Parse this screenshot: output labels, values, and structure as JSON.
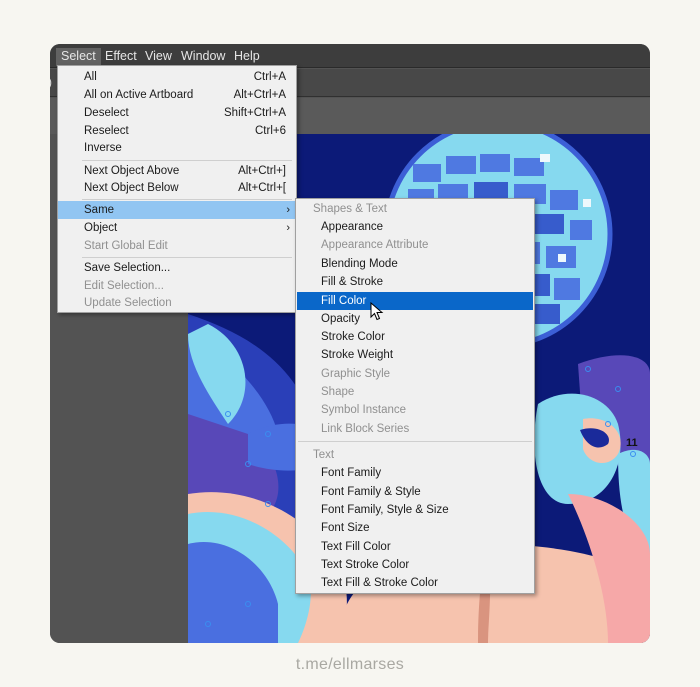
{
  "menubar": {
    "items": [
      {
        "label": "Select"
      },
      {
        "label": "Effect"
      },
      {
        "label": "View"
      },
      {
        "label": "Window"
      },
      {
        "label": "Help"
      }
    ]
  },
  "toolbar_glyph": ")",
  "select_menu": {
    "items": [
      {
        "label": "All",
        "shortcut": "Ctrl+A"
      },
      {
        "label": "All on Active Artboard",
        "shortcut": "Alt+Ctrl+A"
      },
      {
        "label": "Deselect",
        "shortcut": "Shift+Ctrl+A"
      },
      {
        "label": "Reselect",
        "shortcut": "Ctrl+6"
      },
      {
        "label": "Inverse",
        "shortcut": ""
      },
      {
        "label": "Next Object Above",
        "shortcut": "Alt+Ctrl+]"
      },
      {
        "label": "Next Object Below",
        "shortcut": "Alt+Ctrl+["
      },
      {
        "label": "Same",
        "shortcut": "›"
      },
      {
        "label": "Object",
        "shortcut": "›"
      },
      {
        "label": "Start Global Edit",
        "shortcut": ""
      },
      {
        "label": "Save Selection...",
        "shortcut": ""
      },
      {
        "label": "Edit Selection...",
        "shortcut": ""
      },
      {
        "label": "Update Selection",
        "shortcut": ""
      }
    ]
  },
  "same_menu": {
    "section1": "Shapes & Text",
    "items1": [
      "Appearance",
      "Appearance Attribute",
      "Blending Mode",
      "Fill & Stroke",
      "Fill Color",
      "Opacity",
      "Stroke Color",
      "Stroke Weight",
      "Graphic Style",
      "Shape",
      "Symbol Instance",
      "Link Block Series"
    ],
    "section2": "Text",
    "items2": [
      "Font Family",
      "Font Family & Style",
      "Font Family, Style & Size",
      "Font Size",
      "Text Fill Color",
      "Text Stroke Color",
      "Text Fill & Stroke Color"
    ]
  },
  "artwork": {
    "label": "11"
  },
  "caption": "t.me/ellmarses",
  "colors": {
    "menu_highlight_light": "#91c5f2",
    "menu_highlight_dark": "#0a67c9",
    "canvas_navy": "#0c1a78",
    "art_blue": "#4a6fe0",
    "art_cyan": "#86d9ef",
    "art_purple": "#5848b8",
    "art_peach": "#f6c3ae"
  }
}
